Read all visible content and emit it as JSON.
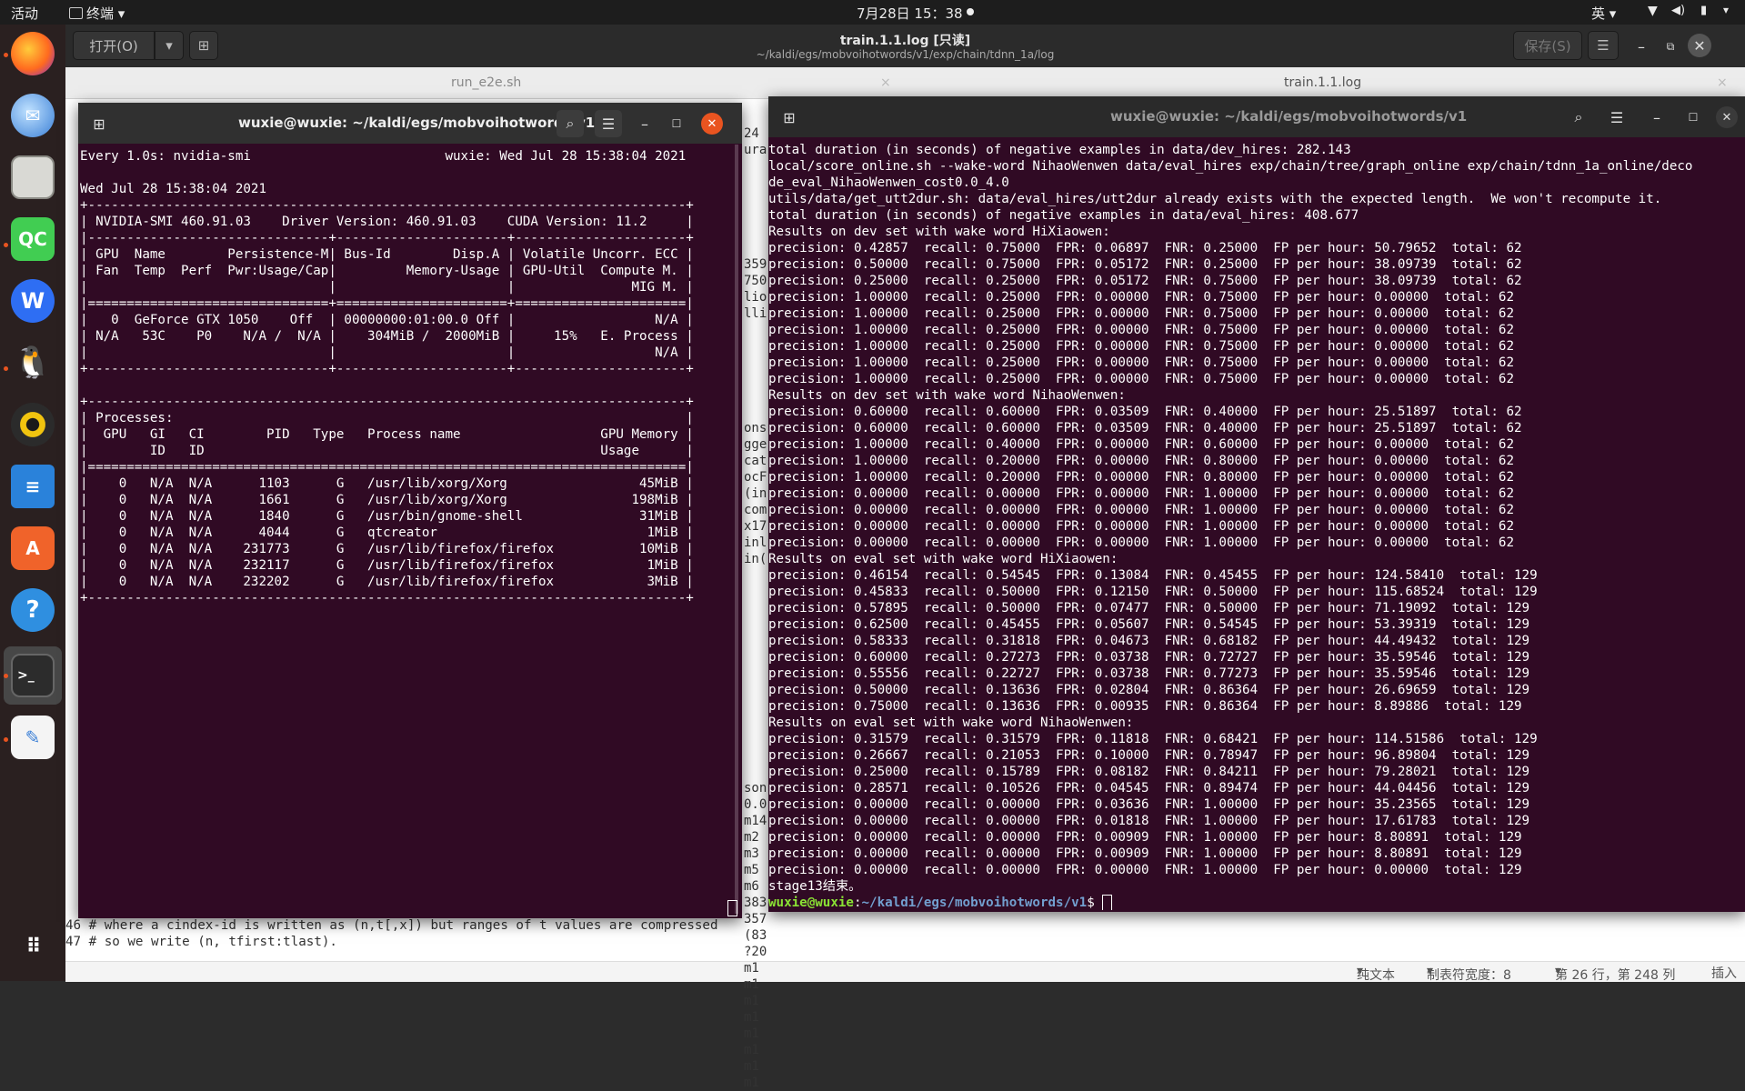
{
  "topbar": {
    "activities": "活动",
    "app_menu": "终端",
    "clock": "7月28日 15：38",
    "input_method": "英"
  },
  "dock": {
    "items": [
      "firefox-icon",
      "thunderbird-icon",
      "files-icon",
      "qtcreator-icon",
      "wps-icon",
      "qq-icon",
      "rhythmbox-icon",
      "writer-icon",
      "software-icon",
      "help-icon",
      "terminal-icon",
      "text-editor-icon",
      "app-grid-icon"
    ],
    "qt_label": "QC"
  },
  "gedit": {
    "open_label": "打开(O)",
    "title": "train.1.1.log [只读]",
    "subtitle": "~/kaldi/egs/mobvoihotwords/v1/exp/chain/tdnn_1a/log",
    "save_label": "保存(S)",
    "tabs": [
      {
        "label": "run_e2e.sh"
      },
      {
        "label": "train.1.1.log"
      }
    ],
    "lines": [
      "46 # where a cindex-id is written as (n,t[,x]) but ranges of t values are compressed",
      "47 # so we write (n, tfirst:tlast)."
    ],
    "status": {
      "format": "纯文本",
      "tab_width": "制表符宽度：8",
      "position": "第 26 行，第 248 列",
      "mode": "插入"
    }
  },
  "term_left": {
    "title": "wuxie@wuxie: ~/kaldi/egs/mobvoihotwords/v1",
    "lines": [
      "Every 1.0s: nvidia-smi                         wuxie: Wed Jul 28 15:38:04 2021",
      "",
      "Wed Jul 28 15:38:04 2021",
      "+-----------------------------------------------------------------------------+",
      "| NVIDIA-SMI 460.91.03    Driver Version: 460.91.03    CUDA Version: 11.2     |",
      "|-------------------------------+----------------------+----------------------+",
      "| GPU  Name        Persistence-M| Bus-Id        Disp.A | Volatile Uncorr. ECC |",
      "| Fan  Temp  Perf  Pwr:Usage/Cap|         Memory-Usage | GPU-Util  Compute M. |",
      "|                               |                      |               MIG M. |",
      "|===============================+======================+======================|",
      "|   0  GeForce GTX 1050    Off  | 00000000:01:00.0 Off |                  N/A |",
      "| N/A   53C    P0    N/A /  N/A |    304MiB /  2000MiB |     15%   E. Process |",
      "|                               |                      |                  N/A |",
      "+-------------------------------+----------------------+----------------------+",
      "",
      "+-----------------------------------------------------------------------------+",
      "| Processes:                                                                  |",
      "|  GPU   GI   CI        PID   Type   Process name                  GPU Memory |",
      "|        ID   ID                                                   Usage      |",
      "|=============================================================================|",
      "|    0   N/A  N/A      1103      G   /usr/lib/xorg/Xorg                 45MiB |",
      "|    0   N/A  N/A      1661      G   /usr/lib/xorg/Xorg                198MiB |",
      "|    0   N/A  N/A      1840      G   /usr/bin/gnome-shell               31MiB |",
      "|    0   N/A  N/A      4044      G   qtcreator                           1MiB |",
      "|    0   N/A  N/A    231773      G   /usr/lib/firefox/firefox           10MiB |",
      "|    0   N/A  N/A    232117      G   /usr/lib/firefox/firefox            1MiB |",
      "|    0   N/A  N/A    232202      G   /usr/lib/firefox/firefox            3MiB |",
      "+-----------------------------------------------------------------------------+"
    ]
  },
  "term_right": {
    "title": "wuxie@wuxie: ~/kaldi/egs/mobvoihotwords/v1",
    "lines": [
      "total duration (in seconds) of negative examples in data/dev_hires: 282.143",
      "local/score_online.sh --wake-word NihaoWenwen data/eval_hires exp/chain/tree/graph_online exp/chain/tdnn_1a_online/deco",
      "de_eval_NihaoWenwen_cost0.0_4.0",
      "utils/data/get_utt2dur.sh: data/eval_hires/utt2dur already exists with the expected length.  We won't recompute it.",
      "total duration (in seconds) of negative examples in data/eval_hires: 408.677",
      "Results on dev set with wake word HiXiaowen:",
      "precision: 0.42857  recall: 0.75000  FPR: 0.06897  FNR: 0.25000  FP per hour: 50.79652  total: 62",
      "precision: 0.50000  recall: 0.75000  FPR: 0.05172  FNR: 0.25000  FP per hour: 38.09739  total: 62",
      "precision: 0.25000  recall: 0.25000  FPR: 0.05172  FNR: 0.75000  FP per hour: 38.09739  total: 62",
      "precision: 1.00000  recall: 0.25000  FPR: 0.00000  FNR: 0.75000  FP per hour: 0.00000  total: 62",
      "precision: 1.00000  recall: 0.25000  FPR: 0.00000  FNR: 0.75000  FP per hour: 0.00000  total: 62",
      "precision: 1.00000  recall: 0.25000  FPR: 0.00000  FNR: 0.75000  FP per hour: 0.00000  total: 62",
      "precision: 1.00000  recall: 0.25000  FPR: 0.00000  FNR: 0.75000  FP per hour: 0.00000  total: 62",
      "precision: 1.00000  recall: 0.25000  FPR: 0.00000  FNR: 0.75000  FP per hour: 0.00000  total: 62",
      "precision: 1.00000  recall: 0.25000  FPR: 0.00000  FNR: 0.75000  FP per hour: 0.00000  total: 62",
      "Results on dev set with wake word NihaoWenwen:",
      "precision: 0.60000  recall: 0.60000  FPR: 0.03509  FNR: 0.40000  FP per hour: 25.51897  total: 62",
      "precision: 0.60000  recall: 0.60000  FPR: 0.03509  FNR: 0.40000  FP per hour: 25.51897  total: 62",
      "precision: 1.00000  recall: 0.40000  FPR: 0.00000  FNR: 0.60000  FP per hour: 0.00000  total: 62",
      "precision: 1.00000  recall: 0.20000  FPR: 0.00000  FNR: 0.80000  FP per hour: 0.00000  total: 62",
      "precision: 1.00000  recall: 0.20000  FPR: 0.00000  FNR: 0.80000  FP per hour: 0.00000  total: 62",
      "precision: 0.00000  recall: 0.00000  FPR: 0.00000  FNR: 1.00000  FP per hour: 0.00000  total: 62",
      "precision: 0.00000  recall: 0.00000  FPR: 0.00000  FNR: 1.00000  FP per hour: 0.00000  total: 62",
      "precision: 0.00000  recall: 0.00000  FPR: 0.00000  FNR: 1.00000  FP per hour: 0.00000  total: 62",
      "precision: 0.00000  recall: 0.00000  FPR: 0.00000  FNR: 1.00000  FP per hour: 0.00000  total: 62",
      "Results on eval set with wake word HiXiaowen:",
      "precision: 0.46154  recall: 0.54545  FPR: 0.13084  FNR: 0.45455  FP per hour: 124.58410  total: 129",
      "precision: 0.45833  recall: 0.50000  FPR: 0.12150  FNR: 0.50000  FP per hour: 115.68524  total: 129",
      "precision: 0.57895  recall: 0.50000  FPR: 0.07477  FNR: 0.50000  FP per hour: 71.19092  total: 129",
      "precision: 0.62500  recall: 0.45455  FPR: 0.05607  FNR: 0.54545  FP per hour: 53.39319  total: 129",
      "precision: 0.58333  recall: 0.31818  FPR: 0.04673  FNR: 0.68182  FP per hour: 44.49432  total: 129",
      "precision: 0.60000  recall: 0.27273  FPR: 0.03738  FNR: 0.72727  FP per hour: 35.59546  total: 129",
      "precision: 0.55556  recall: 0.22727  FPR: 0.03738  FNR: 0.77273  FP per hour: 35.59546  total: 129",
      "precision: 0.50000  recall: 0.13636  FPR: 0.02804  FNR: 0.86364  FP per hour: 26.69659  total: 129",
      "precision: 0.75000  recall: 0.13636  FPR: 0.00935  FNR: 0.86364  FP per hour: 8.89886  total: 129",
      "Results on eval set with wake word NihaoWenwen:",
      "precision: 0.31579  recall: 0.31579  FPR: 0.11818  FNR: 0.68421  FP per hour: 114.51586  total: 129",
      "precision: 0.26667  recall: 0.21053  FPR: 0.10000  FNR: 0.78947  FP per hour: 96.89804  total: 129",
      "precision: 0.25000  recall: 0.15789  FPR: 0.08182  FNR: 0.84211  FP per hour: 79.28021  total: 129",
      "precision: 0.28571  recall: 0.10526  FPR: 0.04545  FNR: 0.89474  FP per hour: 44.04456  total: 129",
      "precision: 0.00000  recall: 0.00000  FPR: 0.03636  FNR: 1.00000  FP per hour: 35.23565  total: 129",
      "precision: 0.00000  recall: 0.00000  FPR: 0.01818  FNR: 1.00000  FP per hour: 17.61783  total: 129",
      "precision: 0.00000  recall: 0.00000  FPR: 0.00909  FNR: 1.00000  FP per hour: 8.80891  total: 129",
      "precision: 0.00000  recall: 0.00000  FPR: 0.00909  FNR: 1.00000  FP per hour: 8.80891  total: 129",
      "precision: 0.00000  recall: 0.00000  FPR: 0.00000  FNR: 1.00000  FP per hour: 0.00000  total: 129",
      "stage13结束。"
    ],
    "prompt_user": "wuxie@wuxie",
    "prompt_sep": ":",
    "prompt_path": "~/kaldi/egs/mobvoihotwords/v1",
    "prompt_end": "$ "
  },
  "peek_gap": {
    "lines": [
      "24",
      "ura",
      "",
      "",
      "",
      "",
      "",
      "",
      "359",
      "750",
      "lio",
      "lli",
      "",
      "",
      "",
      "",
      "",
      "",
      "ons",
      "gge",
      "cat",
      "ocF",
      "(in",
      "com",
      "x17",
      "inl",
      "in(",
      "",
      "",
      "",
      "",
      "",
      "",
      "",
      "",
      "",
      "",
      "",
      "",
      "",
      "son",
      "0.0",
      "m14",
      "m2",
      "m3",
      "m5",
      "m6",
      "383",
      "357",
      "(83",
      "?20",
      "m1",
      "m1",
      "m1",
      "m1",
      "m1",
      "m1",
      "m1",
      "m1"
    ]
  },
  "colors": {
    "terminal_bg": "#300a24",
    "header_bg": "#303030",
    "prompt_green": "#8ae234",
    "prompt_blue": "#729fcf",
    "ubuntu_orange": "#e95420"
  }
}
